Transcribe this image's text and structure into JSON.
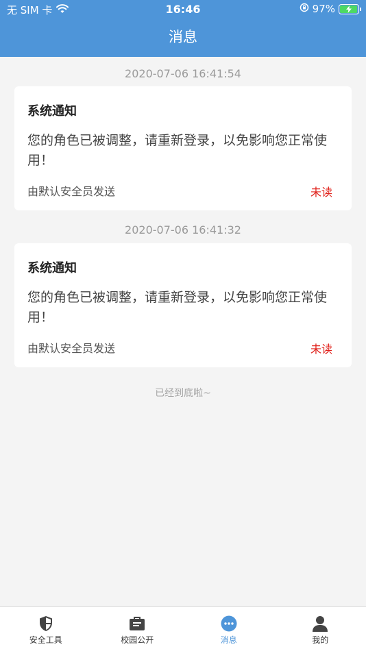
{
  "status_bar": {
    "carrier": "无 SIM 卡",
    "time": "16:46",
    "battery_percent": "97%",
    "battery_level": 0.97
  },
  "nav": {
    "title": "消息"
  },
  "messages": [
    {
      "timestamp": "2020-07-06 16:41:54",
      "title": "系统通知",
      "body": "您的角色已被调整，请重新登录，以免影响您正常使用！",
      "sender": "由默认安全员发送",
      "status": "未读"
    },
    {
      "timestamp": "2020-07-06 16:41:32",
      "title": "系统通知",
      "body": "您的角色已被调整，请重新登录，以免影响您正常使用！",
      "sender": "由默认安全员发送",
      "status": "未读"
    }
  ],
  "footer_note": "已经到底啦~",
  "tabs": [
    {
      "label": "安全工具",
      "icon": "shield-icon"
    },
    {
      "label": "校园公开",
      "icon": "briefcase-icon"
    },
    {
      "label": "消息",
      "icon": "chat-icon",
      "active": true
    },
    {
      "label": "我的",
      "icon": "person-icon"
    }
  ],
  "colors": {
    "header": "#4e95d9",
    "unread": "#e0201a",
    "background": "#f4f4f4"
  }
}
